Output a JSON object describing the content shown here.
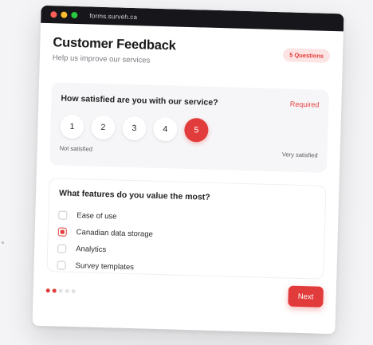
{
  "browser": {
    "url": "forms.surveh.ca"
  },
  "form": {
    "title": "Customer Feedback",
    "subtitle": "Help us improve our services",
    "badge": "5 Questions"
  },
  "question1": {
    "text": "How satisfied are you with our service?",
    "required_label": "Required",
    "scale": [
      "1",
      "2",
      "3",
      "4",
      "5"
    ],
    "selected": "5",
    "low_label": "Not satisfied",
    "high_label": "Very satisfied"
  },
  "question2": {
    "text": "What features do you value the most?",
    "options": [
      {
        "label": "Ease of use",
        "checked": false
      },
      {
        "label": "Canadian data storage",
        "checked": true
      },
      {
        "label": "Analytics",
        "checked": false
      },
      {
        "label": "Survey templates",
        "checked": false
      }
    ]
  },
  "footer": {
    "next_label": "Next",
    "progress": {
      "current_step": 2,
      "total_steps": 5
    }
  },
  "colors": {
    "accent": "#e13b3b",
    "titlebar": "#16161b",
    "badge_bg": "#fde4e4"
  }
}
